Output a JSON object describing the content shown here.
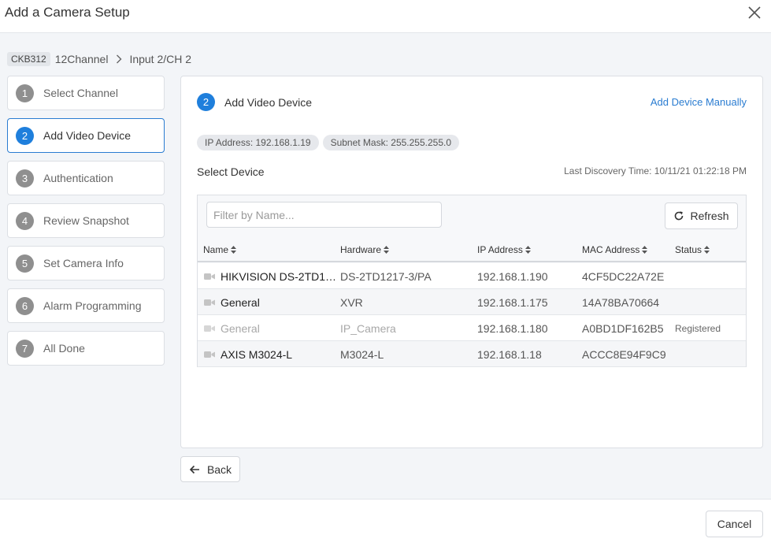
{
  "window": {
    "title": "Add a Camera Setup",
    "close_icon": "close-icon"
  },
  "breadcrumb": {
    "chip": "CKB312",
    "device": "12Channel",
    "channel": "Input 2/CH 2"
  },
  "steps": [
    {
      "num": "1",
      "label": "Select Channel"
    },
    {
      "num": "2",
      "label": "Add Video Device"
    },
    {
      "num": "3",
      "label": "Authentication"
    },
    {
      "num": "4",
      "label": "Review Snapshot"
    },
    {
      "num": "5",
      "label": "Set Camera Info"
    },
    {
      "num": "6",
      "label": "Alarm Programming"
    },
    {
      "num": "7",
      "label": "All Done"
    }
  ],
  "active_step": 2,
  "panel": {
    "step_num": "2",
    "title": "Add Video Device",
    "add_manual": "Add Device Manually",
    "ip_pill": "IP Address: 192.168.1.19",
    "mask_pill": "Subnet Mask: 255.255.255.0",
    "select_device": "Select Device",
    "last_discovery": "Last Discovery Time: 10/11/21 01:22:18 PM",
    "filter_placeholder": "Filter by Name...",
    "refresh_label": "Refresh"
  },
  "table": {
    "headers": [
      "Name",
      "Hardware",
      "IP Address",
      "MAC Address",
      "Status"
    ],
    "rows": [
      {
        "name": "HIKVISION DS-2TD1…",
        "hardware": "DS-2TD1217-3/PA",
        "ip": "192.168.1.190",
        "mac": "4CF5DC22A72E",
        "status": ""
      },
      {
        "name": "General",
        "hardware": "XVR",
        "ip": "192.168.1.175",
        "mac": "14A78BA70664",
        "status": ""
      },
      {
        "name": "General",
        "hardware": "IP_Camera",
        "ip": "192.168.1.180",
        "mac": "A0BD1DF162B5",
        "status": "Registered"
      },
      {
        "name": "AXIS M3024-L",
        "hardware": "M3024-L",
        "ip": "192.168.1.18",
        "mac": "ACCC8E94F9C9",
        "status": ""
      }
    ]
  },
  "buttons": {
    "back": "Back",
    "cancel": "Cancel"
  },
  "colors": {
    "accent": "#1f7fdc",
    "link": "#2a7cd1",
    "inactive_step": "#8f8f8f"
  }
}
